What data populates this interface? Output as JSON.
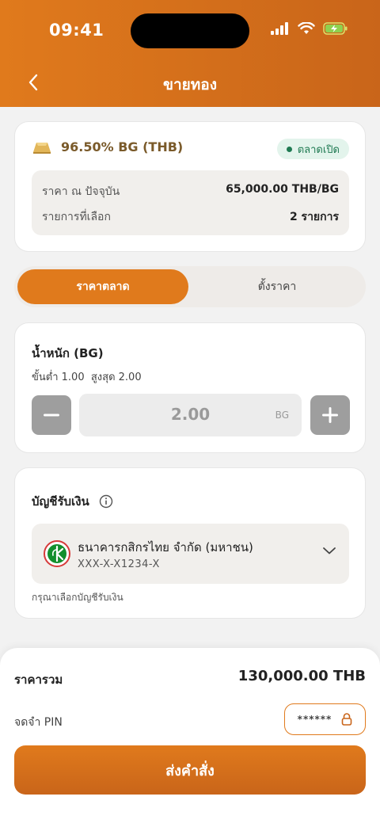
{
  "status": {
    "time": "09:41"
  },
  "header": {
    "title": "ขายทอง"
  },
  "gold": {
    "name": "96.50% BG (THB)",
    "market_status": "ตลาดเปิด",
    "current_price_label": "ราคา ณ ปัจจุบัน",
    "current_price_value": "65,000.00 THB/BG",
    "selected_label": "รายการที่เลือก",
    "selected_value": "2 รายการ"
  },
  "tabs": {
    "market": "ราคาตลาด",
    "set_price": "ตั้งราคา"
  },
  "weight": {
    "title": "น้ำหนัก (BG)",
    "min_label": "ขั้นต่ำ 1.00",
    "max_label": "สูงสุด 2.00",
    "value": "2.00",
    "unit": "BG"
  },
  "account": {
    "title": "บัญชีรับเงิน",
    "bank_name": "ธนาคารกสิกรไทย จำกัด (มหาชน)",
    "account_number": "XXX-X-X1234-X",
    "hint": "กรุณาเลือกบัญชีรับเงิน"
  },
  "summary": {
    "total_label": "ราคารวม",
    "total_value": "130,000.00 THB",
    "pin_label": "จดจำ PIN",
    "pin_mask": "******",
    "submit": "ส่งคำสั่ง"
  },
  "colors": {
    "accent": "#E07A1C",
    "market_badge_bg": "#E3F4EC",
    "market_badge_text": "#1F7A52",
    "bank_green": "#138F2D"
  }
}
